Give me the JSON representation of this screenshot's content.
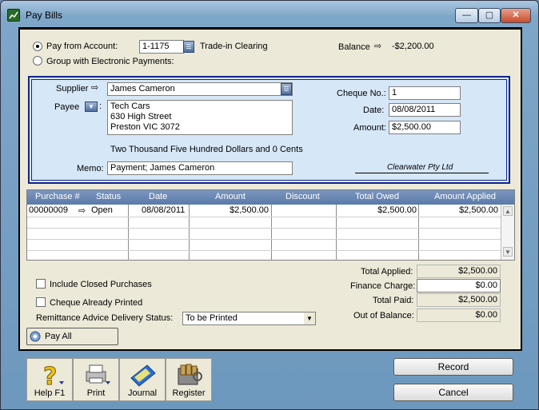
{
  "window": {
    "title": "Pay Bills",
    "minimize": "—",
    "maximize": "▢",
    "close": "✕"
  },
  "account": {
    "pay_from_label": "Pay from Account:",
    "account_number": "1-1175",
    "account_name": "Trade-in Clearing",
    "group_label": "Group with Electronic Payments:",
    "balance_label": "Balance",
    "balance_value": "-$2,200.00"
  },
  "supplier": {
    "supplier_label": "Supplier",
    "supplier_value": "James Cameron",
    "payee_label": "Payee",
    "payee_lines": [
      "Tech Cars",
      "630 High Street",
      "Preston  VIC  3072"
    ],
    "amount_words": "Two Thousand Five Hundred Dollars and 0 Cents",
    "memo_label": "Memo:",
    "memo_value": "Payment; James Cameron",
    "cheque_no_label": "Cheque No.:",
    "cheque_no_value": "1",
    "date_label": "Date:",
    "date_value": "08/08/2011",
    "amount_label": "Amount:",
    "amount_value": "$2,500.00",
    "signature": "Clearwater Pty Ltd"
  },
  "grid": {
    "columns": [
      "Purchase #",
      "Status",
      "Date",
      "Amount",
      "Discount",
      "Total Owed",
      "Amount Applied"
    ],
    "rows": [
      {
        "purchase": "00000009",
        "status": "Open",
        "date": "08/08/2011",
        "amount": "$2,500.00",
        "discount": "",
        "total_owed": "$2,500.00",
        "amount_applied": "$2,500.00"
      }
    ]
  },
  "options": {
    "include_closed": "Include Closed Purchases",
    "cheque_printed": "Cheque Already Printed",
    "remittance_label": "Remittance Advice Delivery Status:",
    "remittance_value": "To be Printed"
  },
  "totals": {
    "total_applied_label": "Total Applied:",
    "total_applied_value": "$2,500.00",
    "finance_charge_label": "Finance Charge:",
    "finance_charge_value": "$0.00",
    "total_paid_label": "Total Paid:",
    "total_paid_value": "$2,500.00",
    "out_of_balance_label": "Out of Balance:",
    "out_of_balance_value": "$0.00"
  },
  "actions": {
    "pay_all": "Pay All",
    "help": "Help F1",
    "print": "Print",
    "journal": "Journal",
    "register": "Register",
    "record": "Record",
    "cancel": "Cancel"
  }
}
